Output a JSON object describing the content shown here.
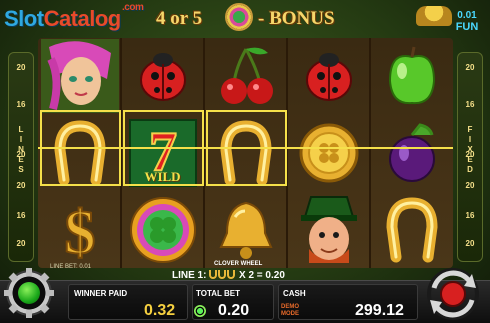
{
  "header": {
    "logo_main": "Slot",
    "logo_accent": "Catalog",
    "logo_suffix": ".com",
    "bonus_left": "4 or 5",
    "bonus_right": "- BONUS",
    "fun_value": "0.01",
    "fun_label": "FUN"
  },
  "paylines": {
    "left": [
      "20",
      "16",
      "20",
      "20",
      "16",
      "20"
    ],
    "right": [
      "20",
      "16",
      "20",
      "20",
      "16",
      "20"
    ],
    "left_word": "LINES",
    "right_word": "FIXED"
  },
  "reels": [
    [
      "fairy",
      "horseshoe",
      "dollar"
    ],
    [
      "ladybug",
      "wild-seven",
      "clover-wheel"
    ],
    [
      "cherries",
      "horseshoe",
      "bell"
    ],
    [
      "ladybug",
      "gold-coin",
      "leprechaun"
    ],
    [
      "apple",
      "plum",
      "horseshoe"
    ]
  ],
  "wild_label": "WILD",
  "info": {
    "line_bet": "LINE BET: 0.01",
    "clover_wheel": "CLOVER WHEEL",
    "line_win_prefix": "LINE 1:",
    "line_win_suffix": "X 2 = 0.20"
  },
  "panel": {
    "winner_paid_label": "WINNER PAID",
    "winner_paid_value": "0.32",
    "total_bet_label": "TOTAL BET",
    "total_bet_value": "0.20",
    "cash_label": "CASH",
    "cash_value": "299.12",
    "demo_line1": "DEMO",
    "demo_line2": "MODE"
  },
  "colors": {
    "accent_yellow": "#f5e04a",
    "value_yellow": "#f5d040",
    "cash_white": "#ffffff",
    "spin_red": "#d82020",
    "logo_blue": "#2fa8e0",
    "logo_red": "#e84a2a"
  },
  "icons": {
    "settings": "gear-icon",
    "spin": "spin-arrows-icon",
    "fun": "fun-icon"
  }
}
